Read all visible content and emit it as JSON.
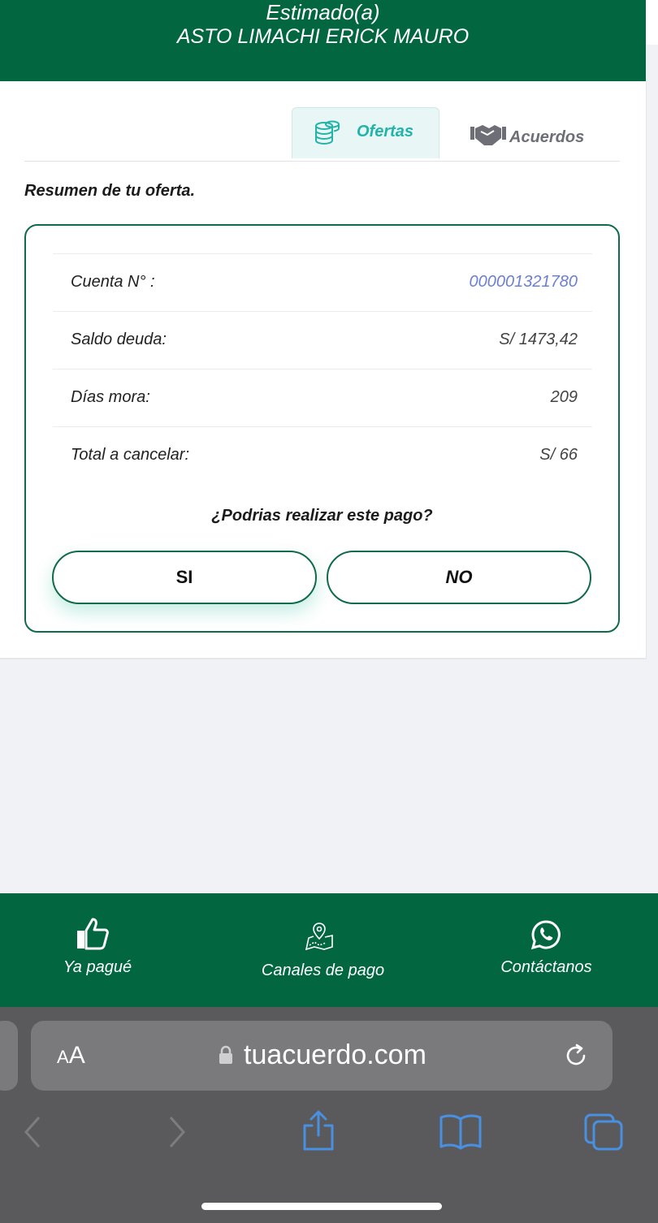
{
  "header": {
    "greeting": "Estimado(a)",
    "customer_name": "ASTO LIMACHI ERICK MAURO"
  },
  "tabs": [
    {
      "label": "Ofertas",
      "icon": "coins-icon",
      "active": true
    },
    {
      "label": "Acuerdos",
      "icon": "handshake-icon",
      "active": false
    }
  ],
  "summary_title": "Resumen de tu oferta.",
  "offer": {
    "rows": [
      {
        "label": "Cuenta N° :",
        "value": "000001321780"
      },
      {
        "label": "Saldo deuda:",
        "value": "S/ 1473,42"
      },
      {
        "label": "Días mora:",
        "value": "209"
      },
      {
        "label": "Total a cancelar:",
        "value": "S/ 66"
      }
    ],
    "question": "¿Podrias realizar este pago?",
    "yes_label": "SI",
    "no_label": "NO"
  },
  "bottom_nav": [
    {
      "label": "Ya pagué",
      "icon": "thumbs-up-icon"
    },
    {
      "label": "Canales de pago",
      "icon": "map-pin-icon"
    },
    {
      "label": "Contáctanos",
      "icon": "whatsapp-icon"
    }
  ],
  "browser": {
    "text_size_label_small": "A",
    "text_size_label_large": "A",
    "url": "tuacuerdo.com"
  },
  "colors": {
    "brand_green": "#026640",
    "accent_teal": "#22b3a9",
    "account_blue": "#6c7fd4",
    "browser_link_blue": "#4a90e2"
  }
}
